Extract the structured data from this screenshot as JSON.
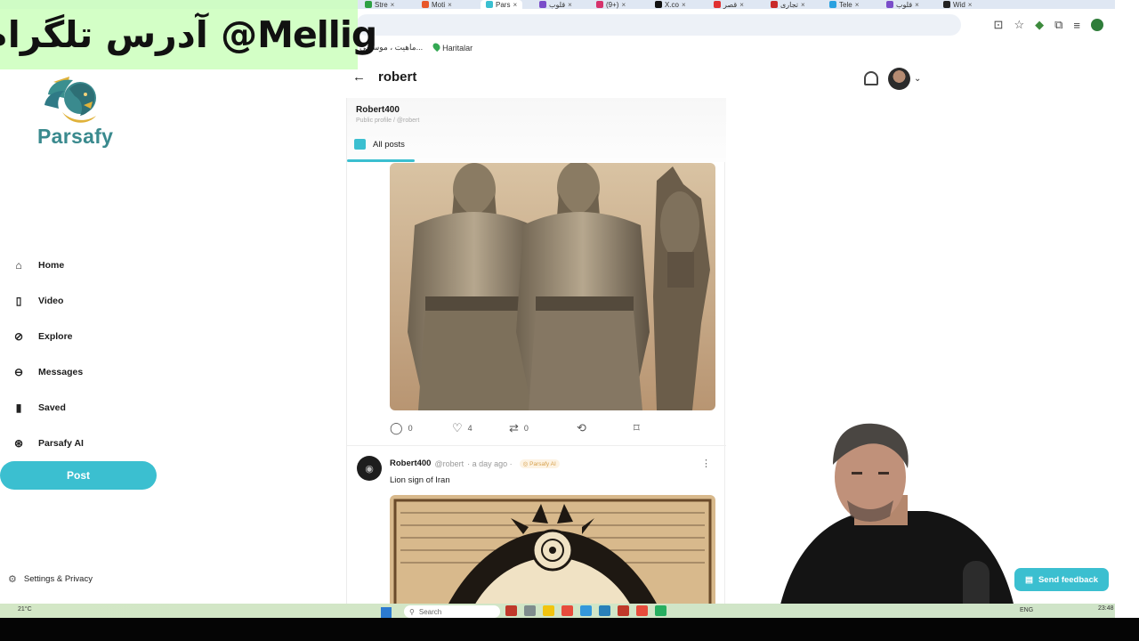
{
  "browser": {
    "tabs": [
      {
        "label": "Stre",
        "color": "#2ea043"
      },
      {
        "label": "Moti",
        "color": "#e8572a"
      },
      {
        "label": "Pars",
        "color": "#3bbfd0",
        "active": true
      },
      {
        "label": "قلوب",
        "color": "#7a4dc9"
      },
      {
        "label": "(9+)",
        "color": "#d6336c"
      },
      {
        "label": "X.co",
        "color": "#111111"
      },
      {
        "label": "قصر",
        "color": "#e03131"
      },
      {
        "label": "تجاری",
        "color": "#c92a2a"
      },
      {
        "label": "Tele",
        "color": "#2aa1e0"
      },
      {
        "label": "قلوب",
        "color": "#7a4dc9"
      },
      {
        "label": "Wid",
        "color": "#222222"
      }
    ],
    "bookmarks": [
      "ماهيت ، موسيقى...",
      "Haritalar"
    ]
  },
  "overlay": {
    "text": "آدرس تلگرام @Mellig"
  },
  "brand": {
    "name": "Parsafy",
    "accent": "#3bbfd0"
  },
  "sidebar": {
    "items": [
      {
        "label": "Home",
        "icon": "home-icon"
      },
      {
        "label": "Video",
        "icon": "video-icon"
      },
      {
        "label": "Explore",
        "icon": "compass-icon"
      },
      {
        "label": "Messages",
        "icon": "message-icon"
      },
      {
        "label": "Saved",
        "icon": "bookmark-icon"
      },
      {
        "label": "Parsafy AI",
        "icon": "ai-icon"
      }
    ],
    "post_label": "Post",
    "settings_label": "Settings & Privacy"
  },
  "header": {
    "title": "robert"
  },
  "profile": {
    "name": "Robert400",
    "subtitle": "Public profile / @robert",
    "tab_label": "All posts"
  },
  "post1": {
    "comments": "0",
    "likes": "4",
    "reposts": "0"
  },
  "post2": {
    "author": "Robert400",
    "handle": "@robert",
    "time": "· a day ago ·",
    "badge": "◎ Parsafy AI",
    "text": "Lion sign of Iran"
  },
  "taskbar": {
    "temp": "21°C",
    "search_placeholder": "Search",
    "lang": "ENG",
    "time": "23:48"
  },
  "feedback": {
    "label": "Send feedback"
  }
}
